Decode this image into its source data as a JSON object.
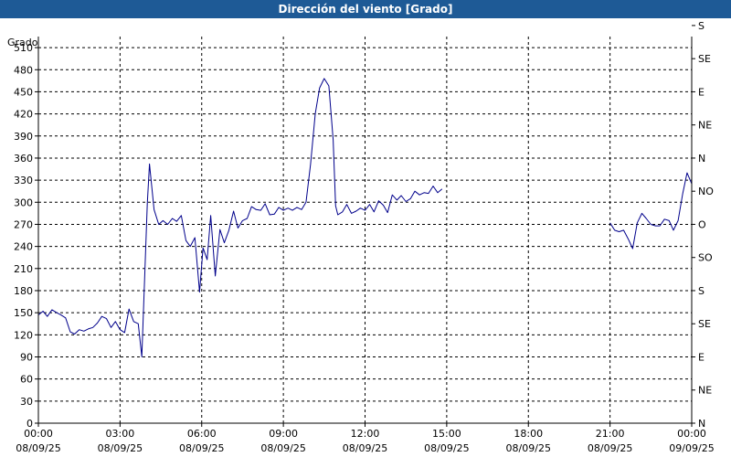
{
  "window": {
    "title": "Dirección del viento [Grado]"
  },
  "chart_data": {
    "type": "line",
    "title": "Dirección del viento [Grado]",
    "ylabel": "Grado",
    "ylim": [
      0,
      525
    ],
    "yticks": [
      0,
      30,
      60,
      90,
      120,
      150,
      180,
      210,
      240,
      270,
      300,
      330,
      360,
      390,
      420,
      450,
      480,
      510
    ],
    "xlim_hours": [
      0,
      24
    ],
    "xticks": [
      {
        "h": 0,
        "time": "00:00",
        "date": "08/09/25"
      },
      {
        "h": 3,
        "time": "03:00",
        "date": "08/09/25"
      },
      {
        "h": 6,
        "time": "06:00",
        "date": "08/09/25"
      },
      {
        "h": 9,
        "time": "09:00",
        "date": "08/09/25"
      },
      {
        "h": 12,
        "time": "12:00",
        "date": "08/09/25"
      },
      {
        "h": 15,
        "time": "15:00",
        "date": "08/09/25"
      },
      {
        "h": 18,
        "time": "18:00",
        "date": "08/09/25"
      },
      {
        "h": 21,
        "time": "21:00",
        "date": "08/09/25"
      },
      {
        "h": 24,
        "time": "00:00",
        "date": "09/09/25"
      }
    ],
    "right_axis": [
      {
        "value": 0,
        "label": "N"
      },
      {
        "value": 45,
        "label": "NE"
      },
      {
        "value": 90,
        "label": "E"
      },
      {
        "value": 135,
        "label": "SE"
      },
      {
        "value": 180,
        "label": "S"
      },
      {
        "value": 225,
        "label": "SO"
      },
      {
        "value": 270,
        "label": "O"
      },
      {
        "value": 315,
        "label": "NO"
      },
      {
        "value": 360,
        "label": "N"
      },
      {
        "value": 405,
        "label": "NE"
      },
      {
        "value": 450,
        "label": "E"
      },
      {
        "value": 495,
        "label": "SE"
      },
      {
        "value": 540,
        "label": "S"
      }
    ],
    "grid": true,
    "series": [
      {
        "color": "#00008b",
        "segments": [
          [
            [
              0.0,
              147
            ],
            [
              0.17,
              152
            ],
            [
              0.33,
              145
            ],
            [
              0.5,
              154
            ],
            [
              0.67,
              150
            ],
            [
              0.83,
              147
            ],
            [
              1.0,
              143
            ],
            [
              1.17,
              124
            ],
            [
              1.33,
              121
            ],
            [
              1.5,
              127
            ],
            [
              1.67,
              125
            ],
            [
              1.83,
              128
            ],
            [
              2.0,
              130
            ],
            [
              2.17,
              136
            ],
            [
              2.33,
              145
            ],
            [
              2.5,
              142
            ],
            [
              2.67,
              130
            ],
            [
              2.83,
              138
            ],
            [
              3.0,
              127
            ],
            [
              3.17,
              123
            ],
            [
              3.33,
              155
            ],
            [
              3.5,
              138
            ],
            [
              3.67,
              135
            ],
            [
              3.8,
              90
            ],
            [
              4.0,
              298
            ],
            [
              4.08,
              352
            ],
            [
              4.25,
              290
            ],
            [
              4.42,
              270
            ],
            [
              4.58,
              275
            ],
            [
              4.75,
              270
            ],
            [
              4.92,
              278
            ],
            [
              5.08,
              274
            ],
            [
              5.25,
              282
            ],
            [
              5.42,
              248
            ],
            [
              5.58,
              240
            ],
            [
              5.75,
              252
            ],
            [
              5.92,
              178
            ],
            [
              6.05,
              238
            ],
            [
              6.2,
              222
            ],
            [
              6.33,
              282
            ],
            [
              6.5,
              200
            ],
            [
              6.67,
              263
            ],
            [
              6.83,
              245
            ],
            [
              7.0,
              262
            ],
            [
              7.17,
              288
            ],
            [
              7.33,
              265
            ],
            [
              7.5,
              275
            ],
            [
              7.67,
              278
            ],
            [
              7.83,
              294
            ],
            [
              8.0,
              290
            ],
            [
              8.17,
              289
            ],
            [
              8.33,
              298
            ],
            [
              8.5,
              283
            ],
            [
              8.67,
              284
            ],
            [
              8.83,
              293
            ],
            [
              9.0,
              289
            ],
            [
              9.17,
              292
            ],
            [
              9.33,
              289
            ],
            [
              9.5,
              293
            ],
            [
              9.67,
              290
            ],
            [
              9.83,
              300
            ],
            [
              10.0,
              352
            ],
            [
              10.17,
              420
            ],
            [
              10.33,
              455
            ],
            [
              10.5,
              468
            ],
            [
              10.67,
              458
            ],
            [
              10.83,
              385
            ],
            [
              10.92,
              295
            ],
            [
              11.0,
              283
            ],
            [
              11.17,
              287
            ],
            [
              11.33,
              297
            ],
            [
              11.5,
              285
            ],
            [
              11.67,
              288
            ],
            [
              11.83,
              292
            ],
            [
              12.0,
              289
            ],
            [
              12.17,
              297
            ],
            [
              12.33,
              287
            ],
            [
              12.5,
              302
            ],
            [
              12.67,
              296
            ],
            [
              12.83,
              286
            ],
            [
              13.0,
              310
            ],
            [
              13.17,
              303
            ],
            [
              13.33,
              309
            ],
            [
              13.5,
              301
            ],
            [
              13.67,
              305
            ],
            [
              13.83,
              315
            ],
            [
              14.0,
              310
            ],
            [
              14.17,
              313
            ],
            [
              14.33,
              312
            ],
            [
              14.5,
              322
            ],
            [
              14.67,
              313
            ],
            [
              14.83,
              318
            ]
          ],
          [
            [
              21.0,
              272
            ],
            [
              21.17,
              262
            ],
            [
              21.33,
              260
            ],
            [
              21.5,
              262
            ],
            [
              21.67,
              250
            ],
            [
              21.83,
              237
            ],
            [
              22.0,
              272
            ],
            [
              22.17,
              285
            ],
            [
              22.33,
              278
            ],
            [
              22.5,
              270
            ],
            [
              22.67,
              268
            ],
            [
              22.83,
              268
            ],
            [
              23.0,
              277
            ],
            [
              23.17,
              275
            ],
            [
              23.33,
              262
            ],
            [
              23.5,
              275
            ],
            [
              23.67,
              312
            ],
            [
              23.83,
              340
            ],
            [
              24.0,
              325
            ]
          ]
        ]
      }
    ]
  }
}
